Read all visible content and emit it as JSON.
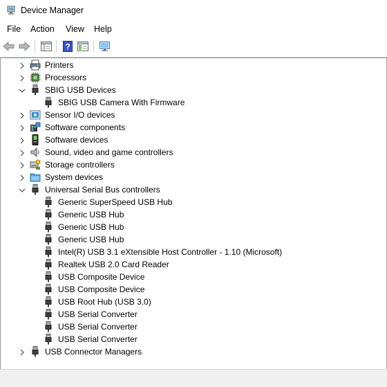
{
  "window": {
    "title": "Device Manager",
    "app_icon": "device-manager-icon"
  },
  "menu": [
    {
      "label": "File"
    },
    {
      "label": "Action"
    },
    {
      "label": "View"
    },
    {
      "label": "Help"
    }
  ],
  "toolbar": {
    "buttons": [
      "back-icon",
      "forward-icon",
      "properties-pane-icon",
      "help-icon",
      "show-hide-console-tree-icon",
      "scan-hardware-monitor-icon"
    ]
  },
  "tree": {
    "rows": [
      {
        "label": "Printers",
        "icon": "printer-icon",
        "expander": "collapsed"
      },
      {
        "label": "Processors",
        "icon": "processor-icon",
        "expander": "collapsed"
      },
      {
        "label": "SBIG USB Devices",
        "icon": "usb-plug-icon",
        "expander": "expanded"
      },
      {
        "label": "SBIG USB Camera With Firmware",
        "icon": "usb-plug-icon",
        "expander": "none"
      },
      {
        "label": "Sensor I/O devices",
        "icon": "sensor-icon",
        "expander": "collapsed"
      },
      {
        "label": "Software components",
        "icon": "software-component-icon",
        "expander": "collapsed"
      },
      {
        "label": "Software devices",
        "icon": "software-device-icon",
        "expander": "collapsed"
      },
      {
        "label": "Sound, video and game controllers",
        "icon": "speaker-icon",
        "expander": "collapsed"
      },
      {
        "label": "Storage controllers",
        "icon": "storage-controller-icon",
        "expander": "collapsed"
      },
      {
        "label": "System devices",
        "icon": "system-folder-icon",
        "expander": "collapsed"
      },
      {
        "label": "Universal Serial Bus controllers",
        "icon": "usb-plug-icon",
        "expander": "expanded"
      },
      {
        "label": "Generic SuperSpeed USB Hub",
        "icon": "usb-plug-icon",
        "expander": "none"
      },
      {
        "label": "Generic USB Hub",
        "icon": "usb-plug-icon",
        "expander": "none"
      },
      {
        "label": "Generic USB Hub",
        "icon": "usb-plug-icon",
        "expander": "none"
      },
      {
        "label": "Generic USB Hub",
        "icon": "usb-plug-icon",
        "expander": "none"
      },
      {
        "label": "Intel(R) USB 3.1 eXtensible Host Controller - 1.10 (Microsoft)",
        "icon": "usb-plug-icon",
        "expander": "none"
      },
      {
        "label": "Realtek USB 2.0 Card Reader",
        "icon": "usb-plug-icon",
        "expander": "none"
      },
      {
        "label": "USB Composite Device",
        "icon": "usb-plug-icon",
        "expander": "none"
      },
      {
        "label": "USB Composite Device",
        "icon": "usb-plug-icon",
        "expander": "none"
      },
      {
        "label": "USB Root Hub (USB 3.0)",
        "icon": "usb-plug-icon",
        "expander": "none"
      },
      {
        "label": "USB Serial Converter",
        "icon": "usb-plug-icon",
        "expander": "none"
      },
      {
        "label": "USB Serial Converter",
        "icon": "usb-plug-icon",
        "expander": "none"
      },
      {
        "label": "USB Serial Converter",
        "icon": "usb-plug-icon",
        "expander": "none"
      },
      {
        "label": "USB Connector Managers",
        "icon": "usb-plug-icon",
        "expander": "collapsed"
      }
    ]
  },
  "statusbar": {
    "text": ""
  }
}
